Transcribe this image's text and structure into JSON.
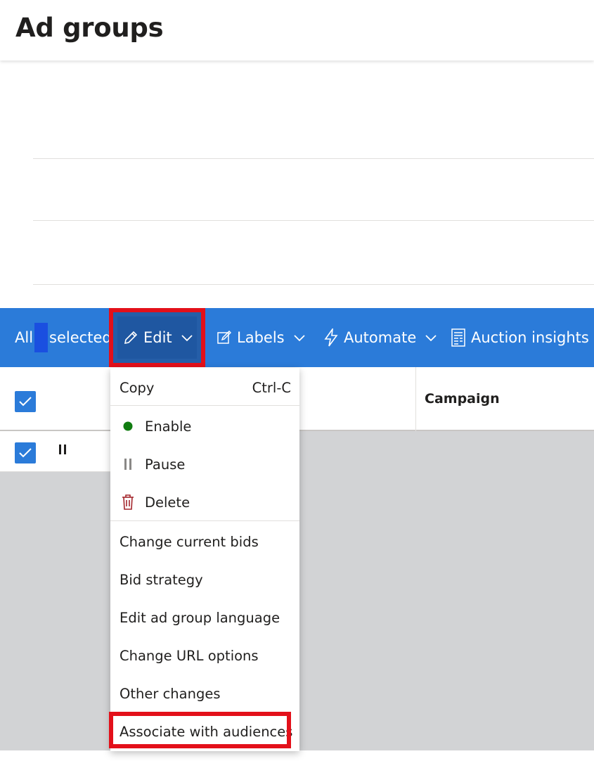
{
  "page": {
    "title": "Ad groups"
  },
  "toolbar": {
    "all_label": "All",
    "selected_label": "selected",
    "edit_label": "Edit",
    "labels_label": "Labels",
    "automate_label": "Automate",
    "auction_label": "Auction insights",
    "bg_color": "#2b7bd9"
  },
  "table": {
    "columns": {
      "campaign": "Campaign"
    },
    "row1": {
      "status_icon": "pause-icon"
    }
  },
  "edit_menu": {
    "copy": {
      "label": "Copy",
      "shortcut": "Ctrl-C"
    },
    "enable": {
      "label": "Enable",
      "icon": "green-dot-icon",
      "color": "#107c10"
    },
    "pause": {
      "label": "Pause",
      "icon": "pause-icon"
    },
    "delete": {
      "label": "Delete",
      "icon": "trash-icon",
      "color": "#a4262c"
    },
    "change_bids": "Change current bids",
    "bid_strategy": "Bid strategy",
    "edit_language": "Edit ad group language",
    "change_url": "Change URL options",
    "other_changes": "Other changes",
    "associate_audiences": "Associate with audiences"
  },
  "highlight_color": "#e3101a"
}
